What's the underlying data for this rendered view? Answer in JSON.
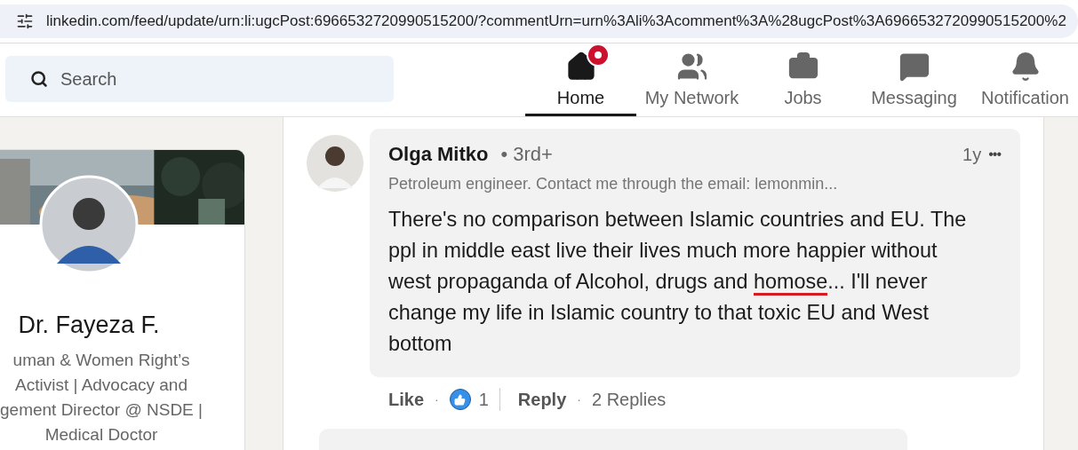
{
  "address_bar": {
    "url": "linkedin.com/feed/update/urn:li:ugcPost:6966532720990515200/?commentUrn=urn%3Ali%3Acomment%3A%28ugcPost%3A6966532720990515200%2"
  },
  "nav": {
    "search": {
      "placeholder": "Search"
    },
    "items": [
      {
        "kind": "home",
        "label": "Home",
        "selected": true,
        "badge": true
      },
      {
        "kind": "network",
        "label": "My Network",
        "selected": false,
        "badge": false
      },
      {
        "kind": "jobs",
        "label": "Jobs",
        "selected": false,
        "badge": false
      },
      {
        "kind": "messaging",
        "label": "Messaging",
        "selected": false,
        "badge": false
      },
      {
        "kind": "notifications",
        "label": "Notification",
        "selected": false,
        "badge": false
      }
    ]
  },
  "profile_card": {
    "name": "Dr. Fayeza F.",
    "headline_lines": [
      "uman & Women Right’s",
      "Activist | Advocacy and",
      "gement Director @ NSDE |",
      "Medical Doctor"
    ]
  },
  "comment": {
    "author": "Olga Mitko",
    "degree": "• 3rd+",
    "time": "1y",
    "more": "•••",
    "headline": "Petroleum engineer. Contact me through the email: lemonmin...",
    "text": {
      "before": "There's no comparison between Islamic countries and EU. The ppl in middle east live their lives much more happier without west propaganda of Alcohol, drugs and ",
      "marked": "homose",
      "after": "... I'll never change my life in Islamic country to that toxic EU and West bottom"
    },
    "actions": {
      "like": "Like",
      "like_separator": "·",
      "reaction_count": "1",
      "reply": "Reply",
      "reply_separator": "·",
      "replies": "2 Replies"
    }
  }
}
